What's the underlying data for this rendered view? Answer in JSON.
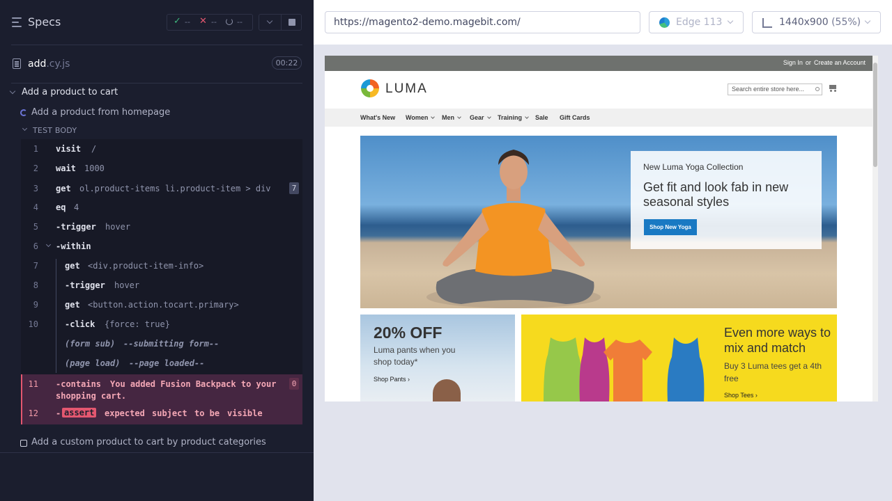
{
  "sidebar": {
    "title": "Specs",
    "stats": {
      "passed": "--",
      "failed": "--",
      "pending": "--"
    },
    "spec": {
      "name": "add",
      "ext": ".cy.js",
      "duration": "00:22"
    },
    "suite": {
      "title": "Add a product to cart"
    },
    "tests": [
      {
        "title": "Add a product from homepage",
        "state": "running"
      },
      {
        "title": "Add a custom product to cart by product categories",
        "state": "pending"
      }
    ],
    "test_body_label": "TEST BODY",
    "commands": [
      {
        "num": "1",
        "name": "visit",
        "msg": "/"
      },
      {
        "num": "2",
        "name": "wait",
        "msg": "1000"
      },
      {
        "num": "3",
        "name": "get",
        "msg": "ol.product-items li.product-item > div",
        "badge": "7"
      },
      {
        "num": "4",
        "name": "eq",
        "msg": "4"
      },
      {
        "num": "5",
        "name": "-trigger",
        "msg": "hover"
      },
      {
        "num": "6",
        "name": "-within",
        "msg": ""
      },
      {
        "num": "7",
        "name": "get",
        "msg": "<div.product-item-info>"
      },
      {
        "num": "8",
        "name": "-trigger",
        "msg": "hover"
      },
      {
        "num": "9",
        "name": "get",
        "msg": "<button.action.tocart.primary>"
      },
      {
        "num": "10",
        "name": "-click",
        "msg": "{force: true}"
      },
      {
        "num": "",
        "name": "(form sub)",
        "msg": "--submitting form--"
      },
      {
        "num": "",
        "name": "(page load)",
        "msg": "--page loaded--"
      },
      {
        "num": "11",
        "name": "-contains",
        "msg_line1": "You added Fusion Backpack to your",
        "msg_line2": "shopping cart.",
        "badge": "0"
      },
      {
        "num": "12",
        "name": "-",
        "tag": "assert",
        "w1": "expected",
        "w2": "subject",
        "w3": "to be",
        "w4": "visible"
      }
    ]
  },
  "browser": {
    "url": "https://magento2-demo.magebit.com/",
    "name": "Edge 113",
    "viewport": "1440x900",
    "scale": "(55%)",
    "icons": [
      "edge-icon",
      "viewport-icon",
      "chevron-down-icon"
    ]
  },
  "site": {
    "sign_in": "Sign In",
    "or": "or",
    "create_account": "Create an Account",
    "logo": "LUMA",
    "search_placeholder": "Search entire store here...",
    "nav": [
      "What's New",
      "Women",
      "Men",
      "Gear",
      "Training",
      "Sale",
      "Gift Cards"
    ],
    "hero": {
      "subtitle": "New Luma Yoga Collection",
      "title": "Get fit and look fab in new seasonal styles",
      "button": "Shop New Yoga"
    },
    "pants": {
      "headline": "20% OFF",
      "desc": "Luma pants when you shop today*",
      "link": "Shop Pants"
    },
    "tees": {
      "headline": "Even more ways to mix and match",
      "desc": "Buy 3 Luma tees get a 4th free",
      "link": "Shop Tees"
    }
  },
  "colors": {
    "panel_bg": "#1b1e2e",
    "error": "#e45770",
    "luma_blue": "#1979c3",
    "tees_yellow": "#f6da1e"
  }
}
